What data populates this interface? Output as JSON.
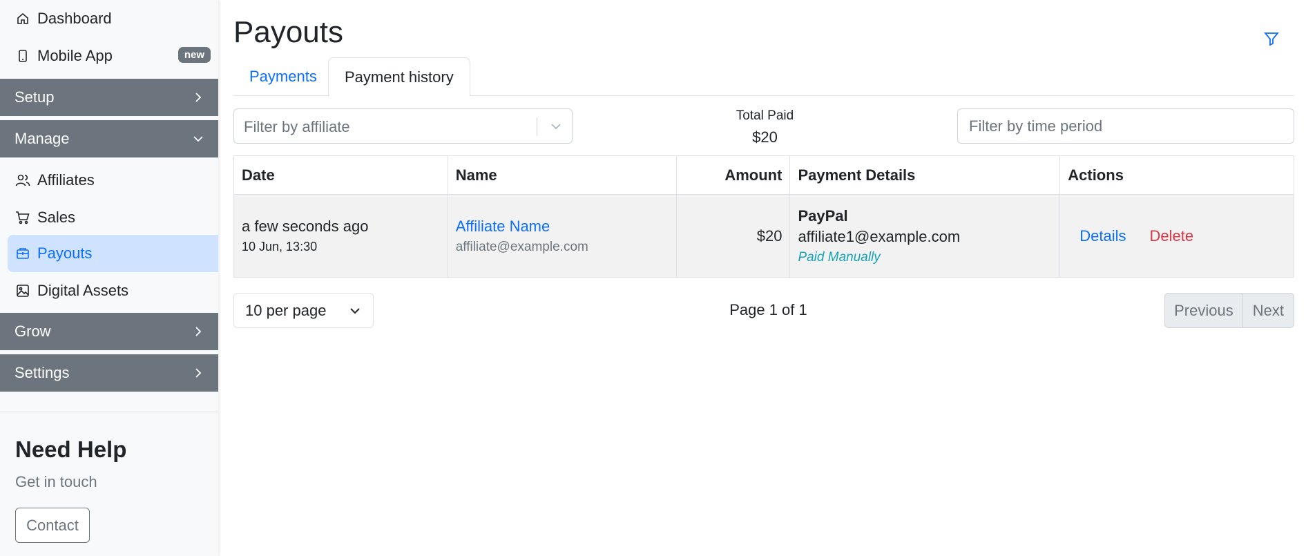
{
  "sidebar": {
    "dashboard": "Dashboard",
    "mobile_app": "Mobile App",
    "mobile_app_badge": "new",
    "sections": {
      "setup": "Setup",
      "manage": "Manage",
      "grow": "Grow",
      "settings": "Settings"
    },
    "manage_items": {
      "affiliates": "Affiliates",
      "sales": "Sales",
      "payouts": "Payouts",
      "digital_assets": "Digital Assets"
    },
    "help": {
      "title": "Need Help",
      "subtitle": "Get in touch",
      "contact": "Contact"
    }
  },
  "main": {
    "title": "Payouts",
    "tabs": {
      "payments": "Payments",
      "history": "Payment history"
    },
    "filters": {
      "affiliate_placeholder": "Filter by affiliate",
      "time_placeholder": "Filter by time period"
    },
    "total": {
      "label": "Total Paid",
      "value": "$20"
    },
    "table": {
      "headers": {
        "date": "Date",
        "name": "Name",
        "amount": "Amount",
        "payment_details": "Payment Details",
        "actions": "Actions"
      },
      "rows": [
        {
          "date_relative": "a few seconds ago",
          "date_exact": "10 Jun, 13:30",
          "name": "Affiliate Name",
          "email": "affiliate@example.com",
          "amount": "$20",
          "method": "PayPal",
          "pay_email": "affiliate1@example.com",
          "status": "Paid Manually",
          "details": "Details",
          "delete": "Delete"
        }
      ]
    },
    "pagination": {
      "per_page": "10 per page",
      "info": "Page 1 of 1",
      "previous": "Previous",
      "next": "Next"
    }
  },
  "colors": {
    "primary": "#0d6efd",
    "danger": "#dc3545",
    "info": "#17a2b8",
    "section_bg": "#6c757d",
    "active_bg": "#cfe2ff"
  }
}
